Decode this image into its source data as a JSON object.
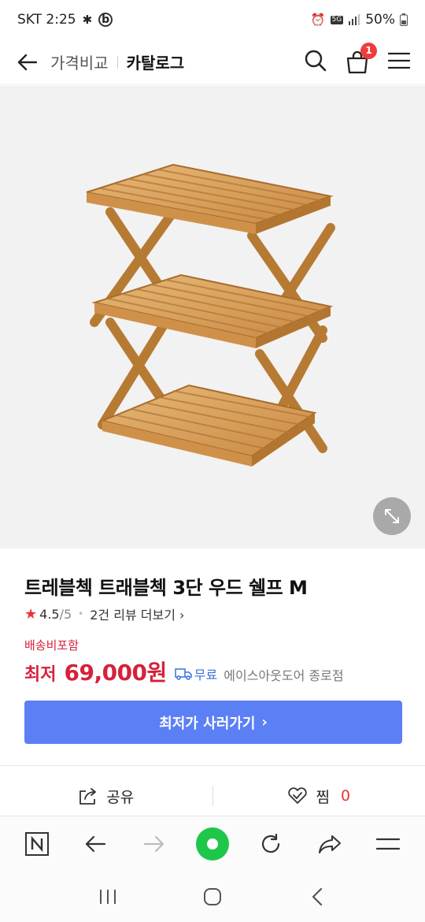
{
  "status_bar": {
    "carrier_time": "SKT 2:25",
    "network": "5G",
    "battery": "50%"
  },
  "header": {
    "breadcrumb_primary": "가격비교",
    "breadcrumb_current": "카탈로그",
    "cart_count": "1"
  },
  "product": {
    "title": "트레블첵 트래블첵 3단 우드 쉘프 M",
    "rating": "4.5",
    "rating_max": "/5",
    "review_link": "2건 리뷰 더보기",
    "shipping_label": "배송비포함",
    "price_label": "최저",
    "price": "69,000원",
    "free_shipping": "무료",
    "store": "에이스아웃도어 종로점",
    "buy_button": "최저가 사러가기"
  },
  "actions": {
    "share_label": "공유",
    "wish_label": "찜",
    "wish_count": "0"
  },
  "icons": [
    "back-arrow-icon",
    "search-icon",
    "cart-icon",
    "menu-icon",
    "expand-icon",
    "star-icon",
    "truck-icon",
    "share-icon",
    "heart-check-icon",
    "naver-n-icon",
    "back-icon",
    "forward-icon",
    "home-green-icon",
    "reload-icon",
    "share-forward-icon",
    "hamburger-icon",
    "recent-apps-icon",
    "home-icon",
    "system-back-icon"
  ],
  "colors": {
    "accent_blue": "#5b7ff5",
    "price_red": "#d6213a",
    "badge_red": "#ef3c3c",
    "green": "#1ec74a"
  }
}
